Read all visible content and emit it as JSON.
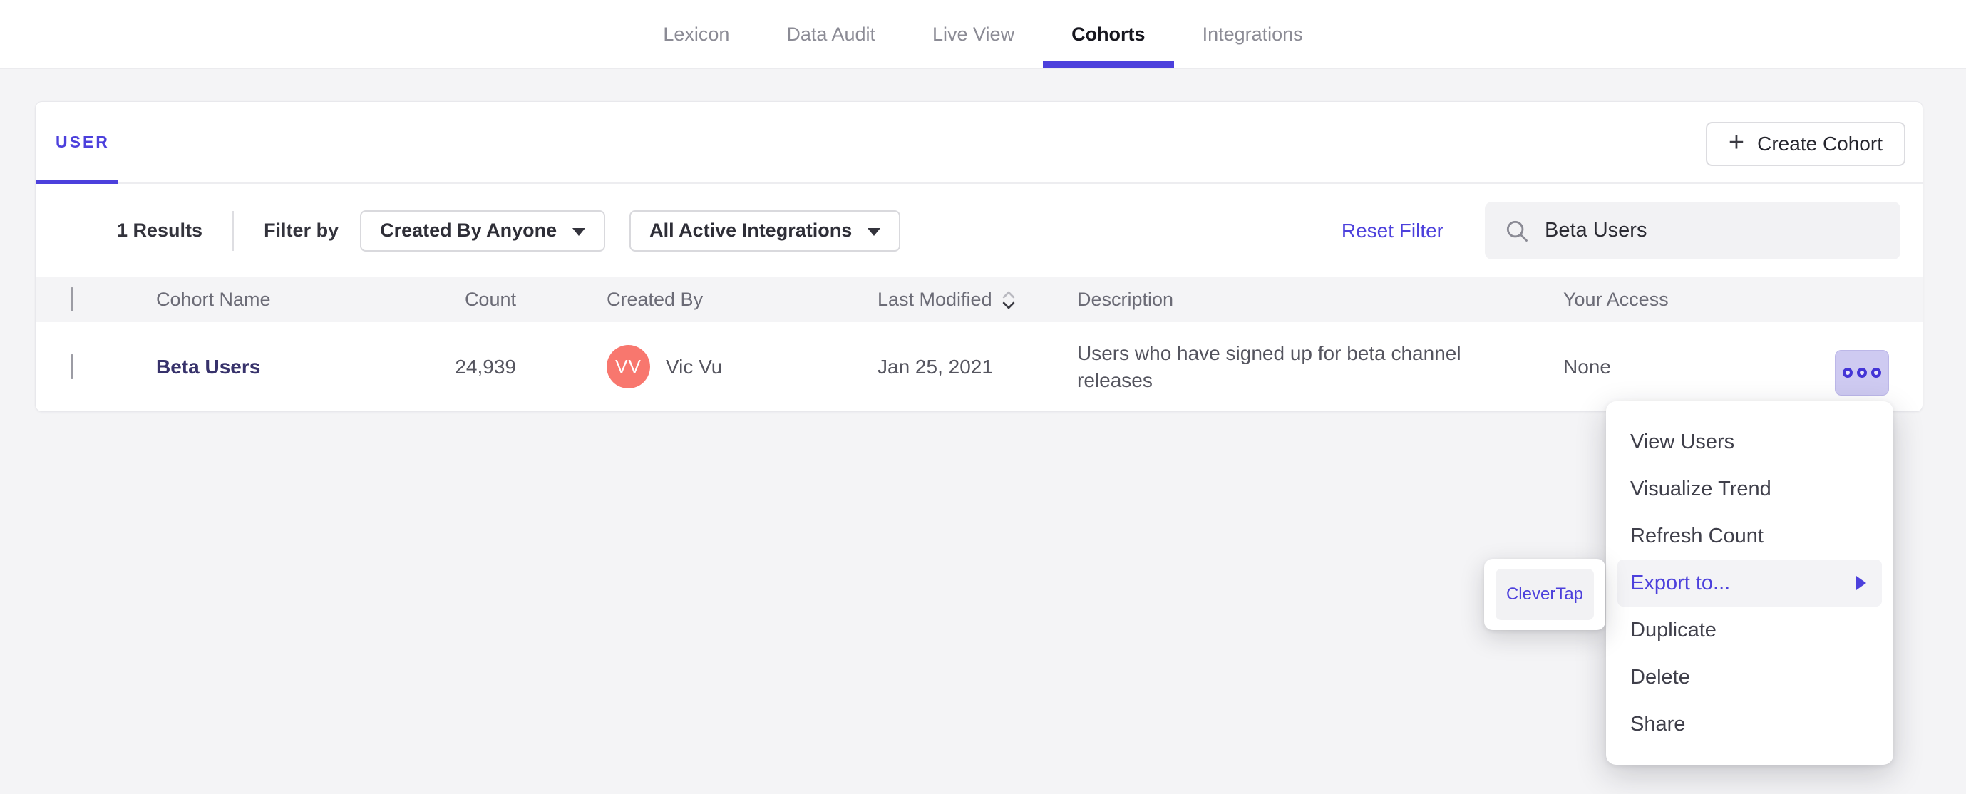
{
  "nav": {
    "items": [
      {
        "label": "Lexicon",
        "active": false
      },
      {
        "label": "Data Audit",
        "active": false
      },
      {
        "label": "Live View",
        "active": false
      },
      {
        "label": "Cohorts",
        "active": true
      },
      {
        "label": "Integrations",
        "active": false
      }
    ]
  },
  "cohorts_card": {
    "tab_label": "USER",
    "create_button_label": "Create Cohort",
    "create_button_plus": "+",
    "filter_bar": {
      "results_count": "1 Results",
      "filter_by_label": "Filter by",
      "created_by_filter": "Created By Anyone",
      "integrations_filter": "All Active Integrations",
      "reset_filter_label": "Reset Filter",
      "search_value": "Beta Users"
    },
    "table": {
      "columns": [
        "Cohort Name",
        "Count",
        "Created By",
        "Last Modified",
        "Description",
        "Your Access"
      ],
      "rows": [
        {
          "name": "Beta Users",
          "count": "24,939",
          "created_by_initials": "VV",
          "created_by_name": "Vic Vu",
          "last_modified": "Jan 25, 2021",
          "description": "Users who have signed up for beta channel releases",
          "your_access": "None"
        }
      ]
    }
  },
  "context_menu": {
    "items": [
      {
        "label": "View Users",
        "highlighted": false
      },
      {
        "label": "Visualize Trend",
        "highlighted": false
      },
      {
        "label": "Refresh Count",
        "highlighted": false
      },
      {
        "label": "Export to...",
        "highlighted": true,
        "has_submenu": true
      },
      {
        "label": "Duplicate",
        "highlighted": false
      },
      {
        "label": "Delete",
        "highlighted": false
      },
      {
        "label": "Share",
        "highlighted": false
      }
    ]
  },
  "export_submenu": {
    "items": [
      {
        "label": "CleverTap"
      }
    ]
  },
  "icons": {
    "plus": "plus-icon",
    "dropdown_caret": "chevron-down-icon",
    "search": "search-icon",
    "sort": "sort-icon",
    "more": "more-options-icon",
    "submenu_arrow": "submenu-arrow-icon"
  },
  "colors": {
    "accent": "#4c40dc",
    "avatar": "#f8776e",
    "cohort_link": "#37326b",
    "more_button_bg": "#cecaf1",
    "menu_highlight_bg": "#f3f3f6",
    "page_background": "#f4f4f6"
  }
}
